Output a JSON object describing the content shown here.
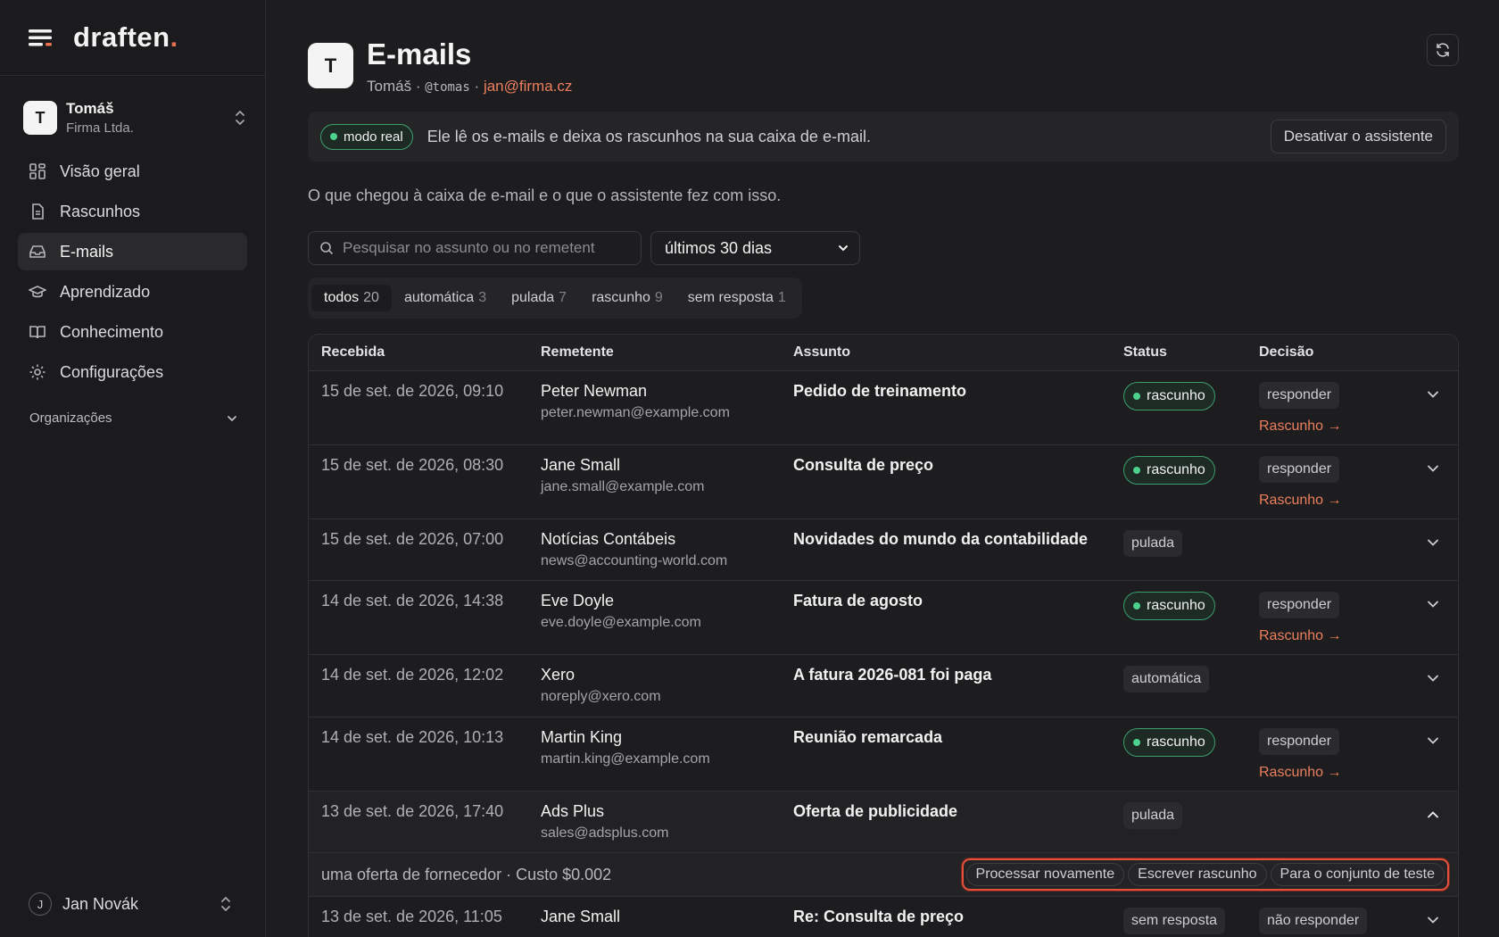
{
  "brand": {
    "name": "draften",
    "dot": "."
  },
  "account": {
    "initial": "T",
    "name": "Tomáš",
    "org": "Firma Ltda."
  },
  "nav": [
    {
      "label": "Visão geral",
      "icon": "grid-icon"
    },
    {
      "label": "Rascunhos",
      "icon": "document-icon"
    },
    {
      "label": "E-mails",
      "icon": "inbox-icon"
    },
    {
      "label": "Aprendizado",
      "icon": "graduation-cap-icon"
    },
    {
      "label": "Conhecimento",
      "icon": "book-icon"
    },
    {
      "label": "Configurações",
      "icon": "gear-icon"
    }
  ],
  "orgs_label": "Organizações",
  "footer_user": {
    "initial": "J",
    "name": "Jan Novák"
  },
  "header": {
    "initial": "T",
    "title": "E-mails",
    "name": "Tomáš",
    "sep": "·",
    "handle": "@tomas",
    "email": "jan@firma.cz"
  },
  "banner": {
    "mode": "modo real",
    "text": "Ele lê os e-mails e deixa os rascunhos na sua caixa de e-mail.",
    "button": "Desativar o assistente"
  },
  "intro": "O que chegou à caixa de e-mail e o que o assistente fez com isso.",
  "search": {
    "placeholder": "Pesquisar no assunto ou no remetent"
  },
  "period": {
    "selected": "últimos 30 dias"
  },
  "tabs": [
    {
      "label": "todos",
      "count": "20"
    },
    {
      "label": "automática",
      "count": "3"
    },
    {
      "label": "pulada",
      "count": "7"
    },
    {
      "label": "rascunho",
      "count": "9"
    },
    {
      "label": "sem resposta",
      "count": "1"
    }
  ],
  "columns": {
    "date": "Recebida",
    "sender": "Remetente",
    "subject": "Assunto",
    "status": "Status",
    "decision": "Decisão"
  },
  "rows": [
    {
      "date": "15 de set. de 2026, 09:10",
      "sender": "Peter Newman",
      "email": "peter.newman@example.com",
      "subject": "Pedido de treinamento",
      "status": "rascunho",
      "decision": "responder",
      "link": "Rascunho →"
    },
    {
      "date": "15 de set. de 2026, 08:30",
      "sender": "Jane Small",
      "email": "jane.small@example.com",
      "subject": "Consulta de preço",
      "status": "rascunho",
      "decision": "responder",
      "link": "Rascunho →"
    },
    {
      "date": "15 de set. de 2026, 07:00",
      "sender": "Notícias Contábeis",
      "email": "news@accounting-world.com",
      "subject": "Novidades do mundo da contabilidade",
      "status": "pulada",
      "decision": "",
      "link": ""
    },
    {
      "date": "14 de set. de 2026, 14:38",
      "sender": "Eve Doyle",
      "email": "eve.doyle@example.com",
      "subject": "Fatura de agosto",
      "status": "rascunho",
      "decision": "responder",
      "link": "Rascunho →"
    },
    {
      "date": "14 de set. de 2026, 12:02",
      "sender": "Xero",
      "email": "noreply@xero.com",
      "subject": "A fatura 2026-081 foi paga",
      "status": "automática",
      "decision": "",
      "link": ""
    },
    {
      "date": "14 de set. de 2026, 10:13",
      "sender": "Martin King",
      "email": "martin.king@example.com",
      "subject": "Reunião remarcada",
      "status": "rascunho",
      "decision": "responder",
      "link": "Rascunho →"
    },
    {
      "date": "13 de set. de 2026, 17:40",
      "sender": "Ads Plus",
      "email": "sales@adsplus.com",
      "subject": "Oferta de publicidade",
      "status": "pulada",
      "decision": "",
      "link": ""
    },
    {
      "date": "13 de set. de 2026, 11:05",
      "sender": "Jane Small",
      "email": "",
      "subject": "Re: Consulta de preço",
      "status": "sem resposta",
      "decision": "não responder",
      "link": ""
    }
  ],
  "expanded": {
    "info": "uma oferta de fornecedor · Custo $0.002",
    "actions": [
      "Processar novamente",
      "Escrever rascunho",
      "Para o conjunto de teste"
    ]
  },
  "colors": {
    "accent": "#ec7f5e",
    "green": "#4cd28c",
    "highlight": "#e5503c"
  }
}
